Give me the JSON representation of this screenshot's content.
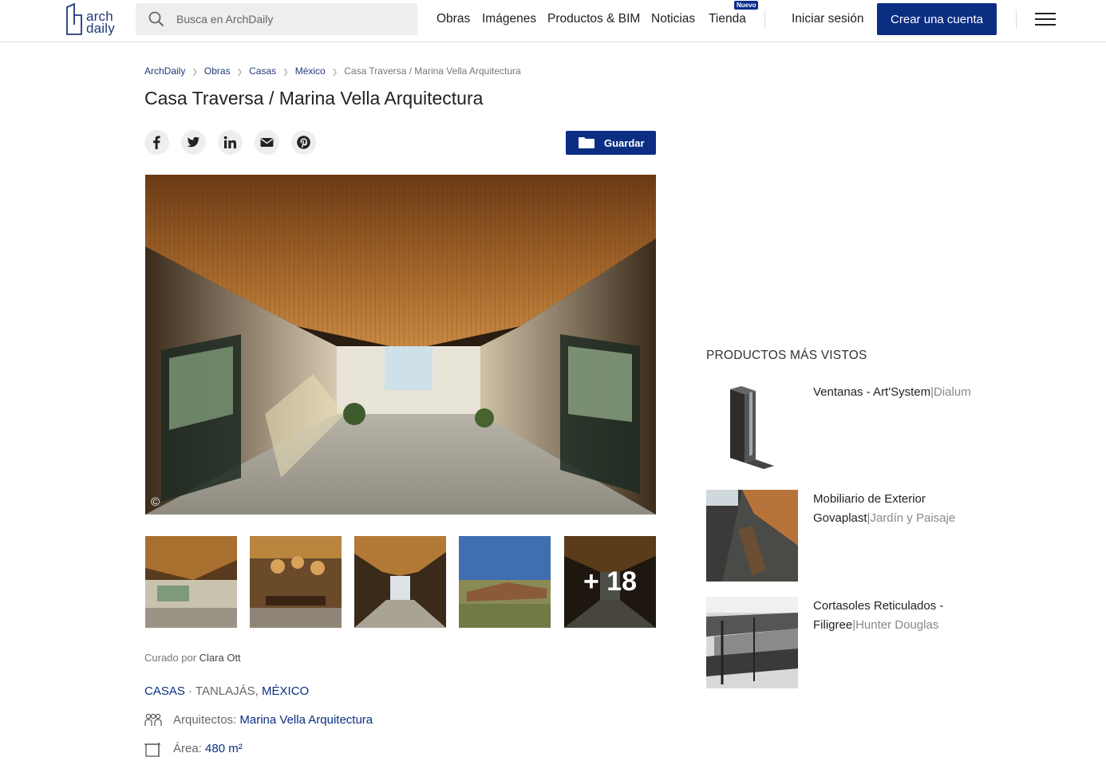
{
  "header": {
    "logo_line1": "arch",
    "logo_line2": "daily",
    "search_placeholder": "Busca en ArchDaily",
    "nav": [
      "Obras",
      "Imágenes",
      "Productos & BIM",
      "Noticias",
      "Tienda"
    ],
    "badge": "Nuevo",
    "login": "Iniciar sesión",
    "create_account": "Crear una cuenta",
    "accent": "#0b2e83"
  },
  "breadcrumb": [
    "ArchDaily",
    "Obras",
    "Casas",
    "México",
    "Casa Traversa / Marina Vella Arquitectura"
  ],
  "article": {
    "title": "Casa Traversa / Marina Vella Arquitectura",
    "share_icons": [
      "facebook-icon",
      "twitter-icon",
      "linkedin-icon",
      "email-icon",
      "pinterest-icon"
    ],
    "save_label": "Guardar",
    "copyright_symbol": "©",
    "more_photos": "+ 18",
    "curated_prefix": "Curado por ",
    "curator": "Clara Ott",
    "category": "CASAS",
    "tag_sep": " · ",
    "location_city": "TANLAJÁS",
    "tag_comma": ", ",
    "location_country": "MÉXICO",
    "architects_label": "Arquitectos:",
    "architects_value": "Marina Vella Arquitectura",
    "area_label": "Área:",
    "area_value": "480 m²"
  },
  "sidebar": {
    "title": "PRODUCTOS MÁS VISTOS",
    "products": [
      {
        "name": "Ventanas - Art'System",
        "brand": "Dialum"
      },
      {
        "name": "Mobiliario de Exterior Govaplast",
        "brand": "Jardín y Paisaje"
      },
      {
        "name": "Cortasoles Reticulados - Filigree",
        "brand": "Hunter Douglas"
      }
    ]
  }
}
